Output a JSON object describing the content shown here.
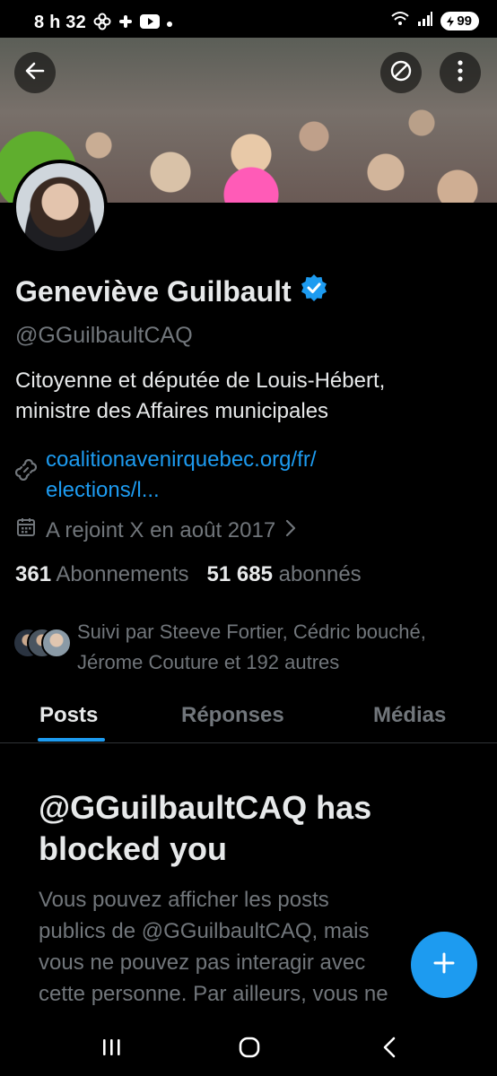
{
  "status_bar": {
    "time": "8 h 32",
    "battery": "99",
    "icons": [
      "pinwheel-icon",
      "slack-icon",
      "youtube-icon",
      "dot-icon",
      "wifi-icon",
      "signal-icon",
      "battery-icon"
    ]
  },
  "header": {
    "back_icon": "arrow-left-icon",
    "block_icon": "blocked-circle-icon",
    "more_icon": "more-vertical-icon"
  },
  "profile": {
    "name": "Geneviève Guilbault",
    "verified": true,
    "handle": "@GGuilbaultCAQ",
    "bio_lines": [
      "Citoyenne et députée de Louis-Hébert,",
      "ministre des Affaires municipales"
    ],
    "link_lines": [
      "coalitionavenirquebec.org/fr/",
      "elections/l..."
    ],
    "joined": "A rejoint X en août 2017",
    "following_count": "361",
    "following_label": "Abonnements",
    "followers_count": "51 685",
    "followers_label": "abonnés",
    "followed_by_lines": [
      "Suivi par Steeve Fortier, Cédric bouché,",
      "Jérome Couture et 192 autres"
    ]
  },
  "tabs": [
    {
      "label": "Posts",
      "active": true
    },
    {
      "label": "Réponses",
      "active": false
    },
    {
      "label": "Médias",
      "active": false
    }
  ],
  "blocked": {
    "title_lines": [
      "@GGuilbaultCAQ has",
      "blocked you"
    ],
    "text_lines": [
      "Vous pouvez afficher les posts",
      "publics de @GGuilbaultCAQ, mais",
      "vous ne pouvez pas interagir avec",
      "cette personne. Par ailleurs, vous ne"
    ]
  },
  "fab_icon": "plus-icon",
  "colors": {
    "accent": "#1d9bf0",
    "background": "#000000",
    "text_primary": "#e7e9ea",
    "text_secondary": "#71767b"
  }
}
